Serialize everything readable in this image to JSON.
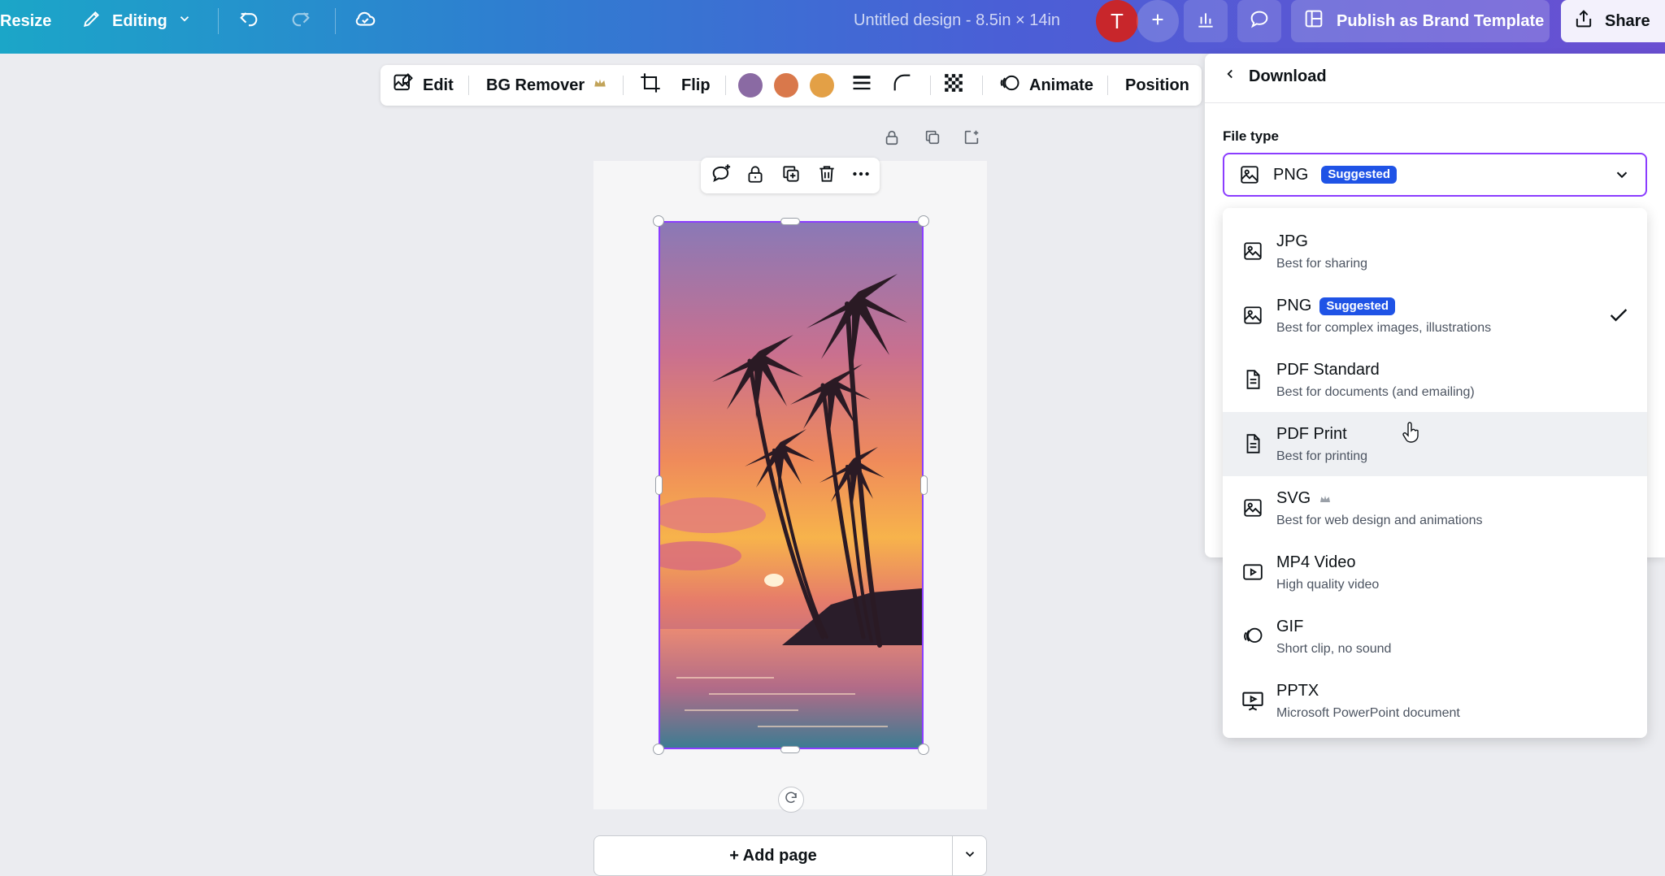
{
  "topbar": {
    "resize_label": "Resize",
    "editing_label": "Editing",
    "design_title": "Untitled design - 8.5in × 14in",
    "avatar_initial": "T",
    "publish_label": "Publish as Brand Template",
    "share_label": "Share"
  },
  "context_toolbar": {
    "edit_label": "Edit",
    "bg_remover_label": "BG Remover",
    "flip_label": "Flip",
    "animate_label": "Animate",
    "position_label": "Position",
    "swatches": [
      "#8a6aa3",
      "#d9784b",
      "#e3a046"
    ]
  },
  "canvas": {
    "add_page_label": "+ Add page"
  },
  "download_panel": {
    "back_label": "Download",
    "file_type_label": "File type",
    "selected": {
      "name": "PNG",
      "badge": "Suggested"
    },
    "options": [
      {
        "name": "JPG",
        "description": "Best for sharing",
        "icon": "image-icon"
      },
      {
        "name": "PNG",
        "badge": "Suggested",
        "description": "Best for complex images, illustrations",
        "icon": "image-icon",
        "selected": true
      },
      {
        "name": "PDF Standard",
        "description": "Best for documents (and emailing)",
        "icon": "document-icon"
      },
      {
        "name": "PDF Print",
        "description": "Best for printing",
        "icon": "document-icon",
        "hovered": true
      },
      {
        "name": "SVG",
        "description": "Best for web design and animations",
        "icon": "image-icon",
        "premium": true
      },
      {
        "name": "MP4 Video",
        "description": "High quality video",
        "icon": "video-icon"
      },
      {
        "name": "GIF",
        "description": "Short clip, no sound",
        "icon": "gif-icon"
      },
      {
        "name": "PPTX",
        "description": "Microsoft PowerPoint document",
        "icon": "presentation-icon"
      }
    ]
  },
  "colors": {
    "accent": "#8b3dff",
    "badge": "#1f53e6",
    "avatar": "#c8262b"
  }
}
